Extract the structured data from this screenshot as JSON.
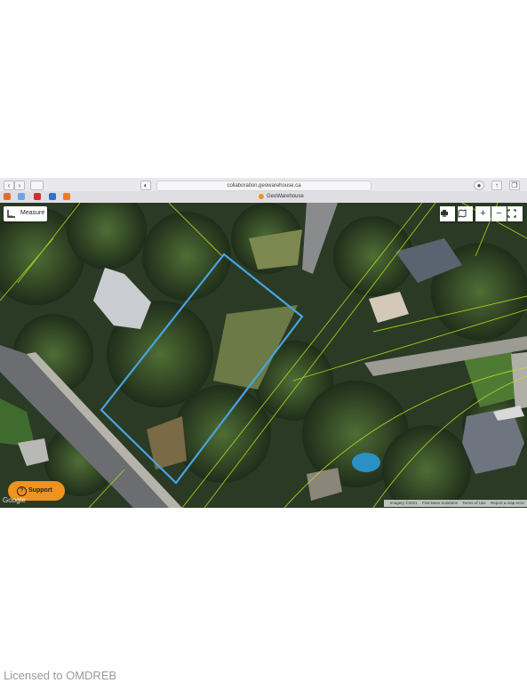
{
  "browser": {
    "url": "collaboration.geowarehouse.ca",
    "tab_title": "GeoWarehouse"
  },
  "map": {
    "measure_label": "Measure",
    "support_label": "Support",
    "google_watermark": "Google",
    "attribution": {
      "imagery": "Imagery ©2021",
      "provider": "First Base Solutions",
      "terms": "Terms of Use",
      "report": "Report a map error"
    },
    "controls": [
      "print-icon",
      "map-layers-icon",
      "zoom-in",
      "zoom-out",
      "fullscreen-icon"
    ],
    "zoom_in_symbol": "+",
    "zoom_out_symbol": "−",
    "colors": {
      "parcel_outline": "#4aa3df",
      "lot_lines": "#b8e01a",
      "support_button": "#f0921f"
    }
  },
  "footer": {
    "license": "Licensed to OMDREB"
  }
}
